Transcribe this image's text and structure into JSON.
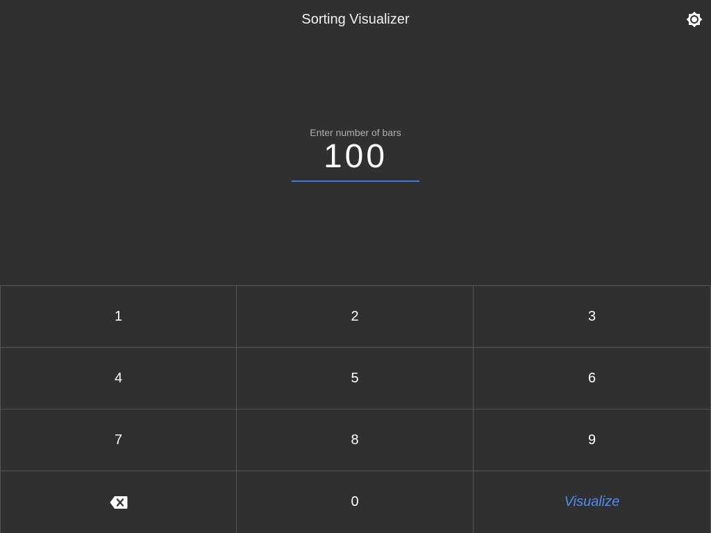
{
  "header": {
    "title": "Sorting Visualizer",
    "theme_icon": "brightness-icon"
  },
  "input": {
    "label": "Enter number of bars",
    "value": "100",
    "underline_color": "#3f7ad6"
  },
  "keypad": {
    "keys": [
      {
        "label": "1",
        "name": "key-1"
      },
      {
        "label": "2",
        "name": "key-2"
      },
      {
        "label": "3",
        "name": "key-3"
      },
      {
        "label": "4",
        "name": "key-4"
      },
      {
        "label": "5",
        "name": "key-5"
      },
      {
        "label": "6",
        "name": "key-6"
      },
      {
        "label": "7",
        "name": "key-7"
      },
      {
        "label": "8",
        "name": "key-8"
      },
      {
        "label": "9",
        "name": "key-9"
      },
      {
        "label": "",
        "name": "backspace-key",
        "icon": "backspace-icon"
      },
      {
        "label": "0",
        "name": "key-0"
      },
      {
        "label": "Visualize",
        "name": "visualize-button"
      }
    ]
  },
  "colors": {
    "background": "#303030",
    "accent": "#4a8ef0",
    "divider": "#555555"
  }
}
